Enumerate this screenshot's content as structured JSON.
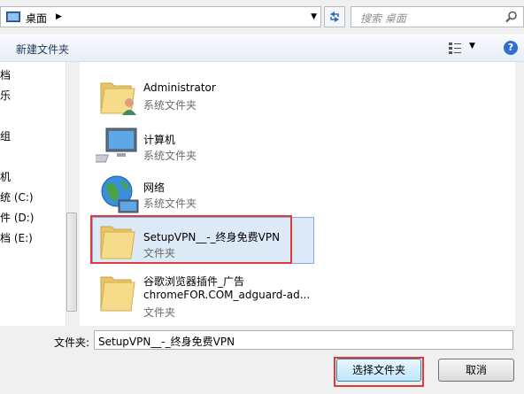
{
  "address": {
    "location": "桌面",
    "arrow": "▶",
    "dropdown": "▼"
  },
  "refresh_icon": "refresh-icon",
  "search": {
    "placeholder": "搜索 桌面"
  },
  "toolbar": {
    "new_folder": "新建文件夹",
    "view_dropdown": "▼",
    "help": "?"
  },
  "nav": {
    "items": [
      "档",
      "乐",
      "组",
      "机",
      "统 (C:)",
      "件 (D:)",
      "档 (E:)"
    ]
  },
  "items": [
    {
      "name": "Administrator",
      "type": "系统文件夹",
      "icon": "user-folder-icon"
    },
    {
      "name": "计算机",
      "type": "系统文件夹",
      "icon": "computer-icon"
    },
    {
      "name": "网络",
      "type": "系统文件夹",
      "icon": "network-globe-icon"
    },
    {
      "name": "SetupVPN__-_终身免费VPN",
      "type": "文件夹",
      "icon": "folder-icon",
      "selected": true
    },
    {
      "name": "谷歌浏览器插件_广告",
      "name2": "chromeFOR.COM_adguard-ad...",
      "type": "文件夹",
      "icon": "folder-icon"
    }
  ],
  "bottom": {
    "folder_label": "文件夹:",
    "folder_value": "SetupVPN__-_终身免费VPN",
    "select_button": "选择文件夹",
    "cancel_button": "取消"
  },
  "colors": {
    "selection_bg": "#dceaf8",
    "highlight_box": "#e0393c",
    "help_icon": "#2f6fcf"
  }
}
